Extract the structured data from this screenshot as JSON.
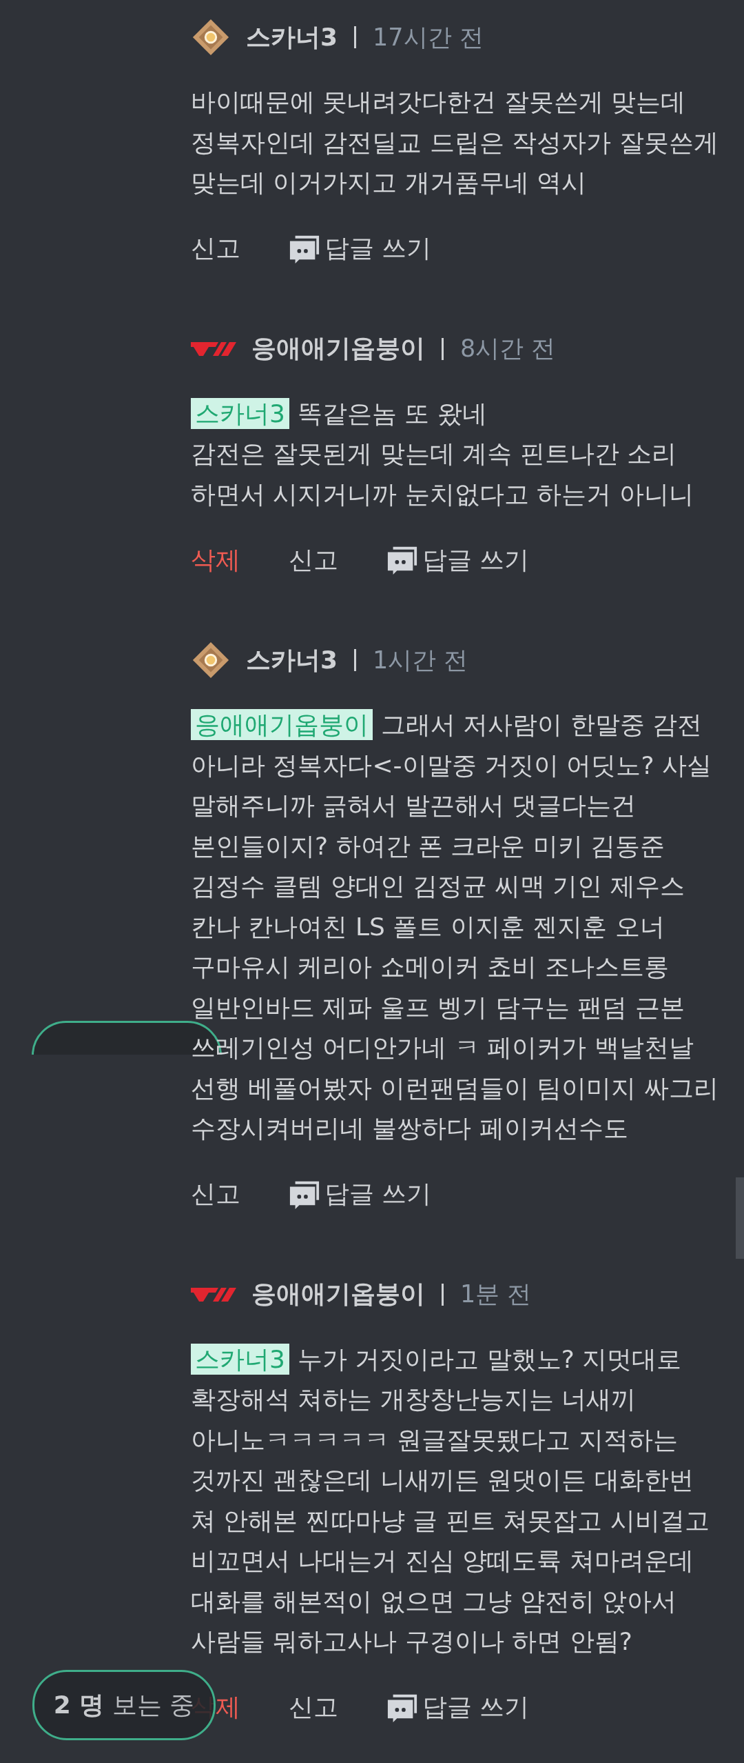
{
  "comments": [
    {
      "author": {
        "kind": "diamond",
        "name": "스카너3"
      },
      "time": "17시간 전",
      "body": "바이때문에 못내려갓다한건 잘못쓴게 맞는데\n정복자인데 감전딜교 드립은 작성자가 잘못쓴게\n맞는데 이거가지고 개거품무네 역시",
      "actions": [
        {
          "kind": "report",
          "label": "신고"
        },
        {
          "kind": "reply",
          "label": "답글 쓰기"
        }
      ]
    },
    {
      "author": {
        "kind": "t1",
        "name": "응애애기옵붕이"
      },
      "time": "8시간 전",
      "mention": "스카너3",
      "body": "똑같은놈 또 왔네\n감전은 잘못된게 맞는데 계속 핀트나간 소리\n하면서 시지거니까 눈치없다고 하는거 아니니",
      "actions": [
        {
          "kind": "delete",
          "label": "삭제"
        },
        {
          "kind": "report",
          "label": "신고"
        },
        {
          "kind": "reply",
          "label": "답글 쓰기"
        }
      ]
    },
    {
      "author": {
        "kind": "diamond",
        "name": "스카너3"
      },
      "time": "1시간 전",
      "mention": "응애애기옵붕이",
      "body": "그래서 저사람이 한말중 감전\n아니라 정복자다<-이말중 거짓이 어딧노? 사실\n말해주니까 긁혀서 발끈해서 댓글다는건\n본인들이지? 하여간 폰 크라운 미키 김동준\n김정수 클템 양대인 김정균 씨맥 기인 제우스\n칸나 칸나여친 LS 폴트 이지훈 젠지훈 오너\n구마유시 케리아 쇼메이커 쵸비 조나스트롱\n일반인바드 제파 울프 벵기 담구는 팬덤 근본\n쓰레기인성 어디안가네 ㅋ 페이커가 백날천날\n선행 베풀어봤자 이런팬덤들이 팀이미지 싸그리\n수장시켜버리네 불쌍하다 페이커선수도",
      "actions": [
        {
          "kind": "report",
          "label": "신고"
        },
        {
          "kind": "reply",
          "label": "답글 쓰기"
        }
      ]
    },
    {
      "author": {
        "kind": "t1",
        "name": "응애애기옵붕이"
      },
      "time": "1분 전",
      "mention": "스카너3",
      "body": "누가 거짓이라고 말했노? 지멋대로\n확장해석 쳐하는 개창창난능지는 너새끼\n아니노ㅋㅋㅋㅋㅋ 원글잘못됐다고 지적하는\n것까진 괜찮은데 니새끼든 원댓이든 대화한번\n쳐 안해본 찐따마냥 글 핀트 쳐못잡고 시비걸고\n비꼬면서 나대는거 진심 양떼도륙 쳐마려운데\n대화를 해본적이 없으면 그냥 얌전히 앉아서\n사람들 뭐하고사나 구경이나 하면 안됨?",
      "actions": [
        {
          "kind": "delete",
          "label": "삭제"
        },
        {
          "kind": "report",
          "label": "신고"
        },
        {
          "kind": "reply",
          "label": "답글 쓰기"
        }
      ]
    }
  ],
  "viewers": {
    "label": "**2 명** 보는 중"
  }
}
